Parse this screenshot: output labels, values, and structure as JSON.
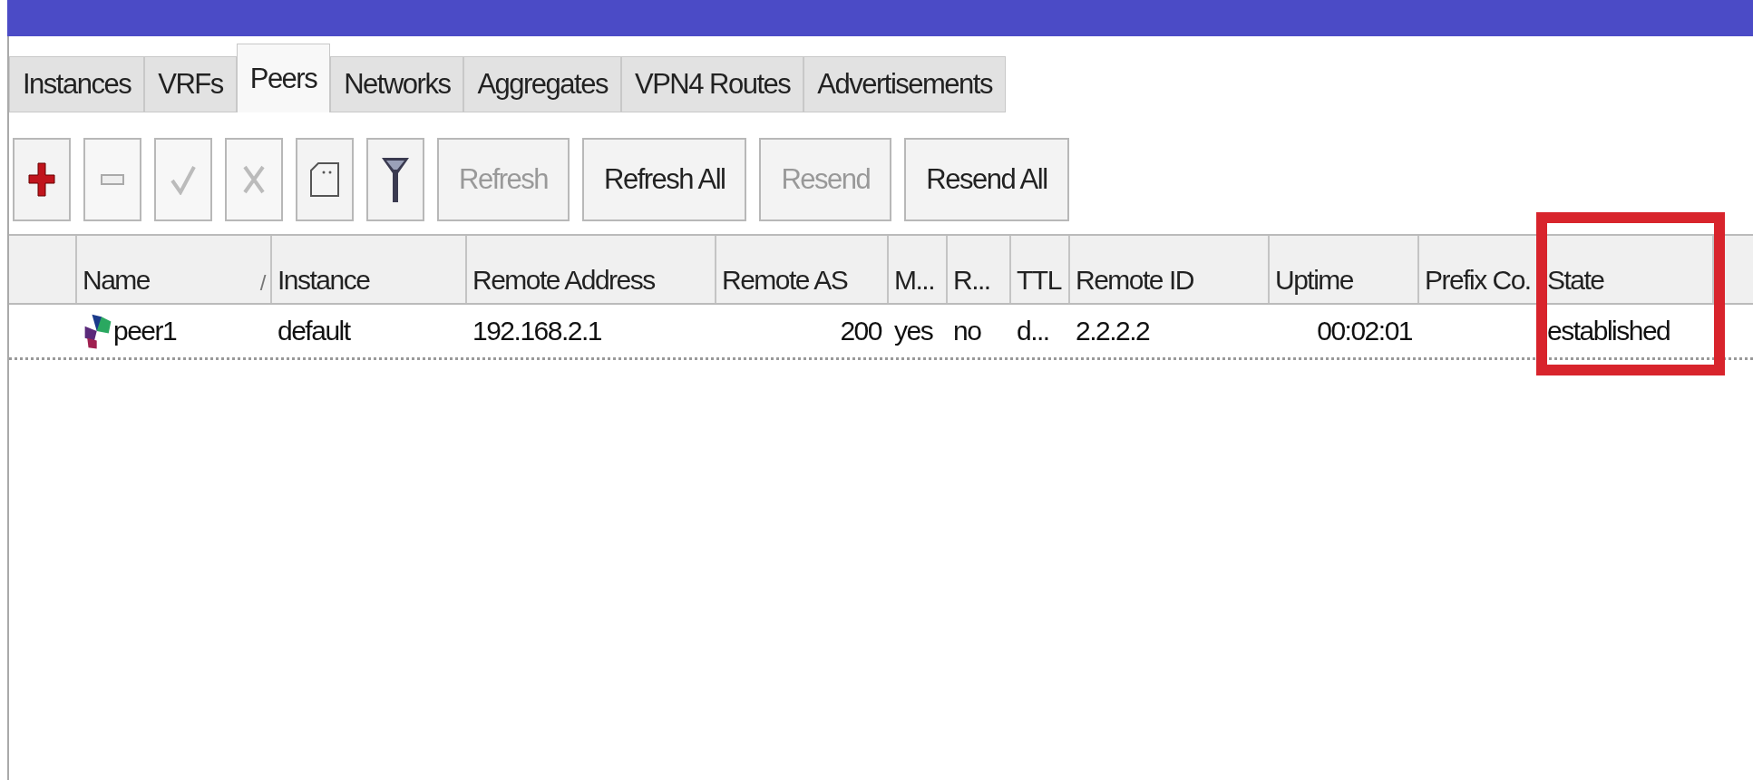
{
  "tabs": [
    {
      "label": "Instances",
      "selected": false
    },
    {
      "label": "VRFs",
      "selected": false
    },
    {
      "label": "Peers",
      "selected": true
    },
    {
      "label": "Networks",
      "selected": false
    },
    {
      "label": "Aggregates",
      "selected": false
    },
    {
      "label": "VPN4 Routes",
      "selected": false
    },
    {
      "label": "Advertisements",
      "selected": false
    }
  ],
  "toolbar": [
    {
      "kind": "add",
      "disabled": false
    },
    {
      "kind": "remove",
      "disabled": true
    },
    {
      "kind": "enable",
      "disabled": true
    },
    {
      "kind": "disable",
      "disabled": true
    },
    {
      "kind": "comment",
      "disabled": false
    },
    {
      "kind": "filter",
      "disabled": false
    },
    {
      "kind": "text",
      "label": "Refresh",
      "disabled": true
    },
    {
      "kind": "text",
      "label": "Refresh All",
      "disabled": false
    },
    {
      "kind": "text",
      "label": "Resend",
      "disabled": true
    },
    {
      "kind": "text",
      "label": "Resend All",
      "disabled": false
    }
  ],
  "table": {
    "columns": [
      {
        "label": "Name",
        "sort_mark": "/",
        "highlighted": false
      },
      {
        "label": "Instance",
        "highlighted": false
      },
      {
        "label": "Remote Address",
        "highlighted": false
      },
      {
        "label": "Remote AS",
        "highlighted": false
      },
      {
        "label": "M...",
        "highlighted": false
      },
      {
        "label": "R...",
        "highlighted": false
      },
      {
        "label": "TTL",
        "highlighted": false
      },
      {
        "label": "Remote ID",
        "highlighted": false
      },
      {
        "label": "Uptime",
        "highlighted": false
      },
      {
        "label": "Prefix Co.",
        "highlighted": false
      },
      {
        "label": "State",
        "highlighted": true
      }
    ],
    "rows": [
      {
        "cells": [
          "peer1",
          "default",
          "192.168.2.1",
          "200",
          "yes",
          "no",
          "d...",
          "2.2.2.2",
          "00:02:01",
          "",
          "established"
        ]
      }
    ]
  }
}
